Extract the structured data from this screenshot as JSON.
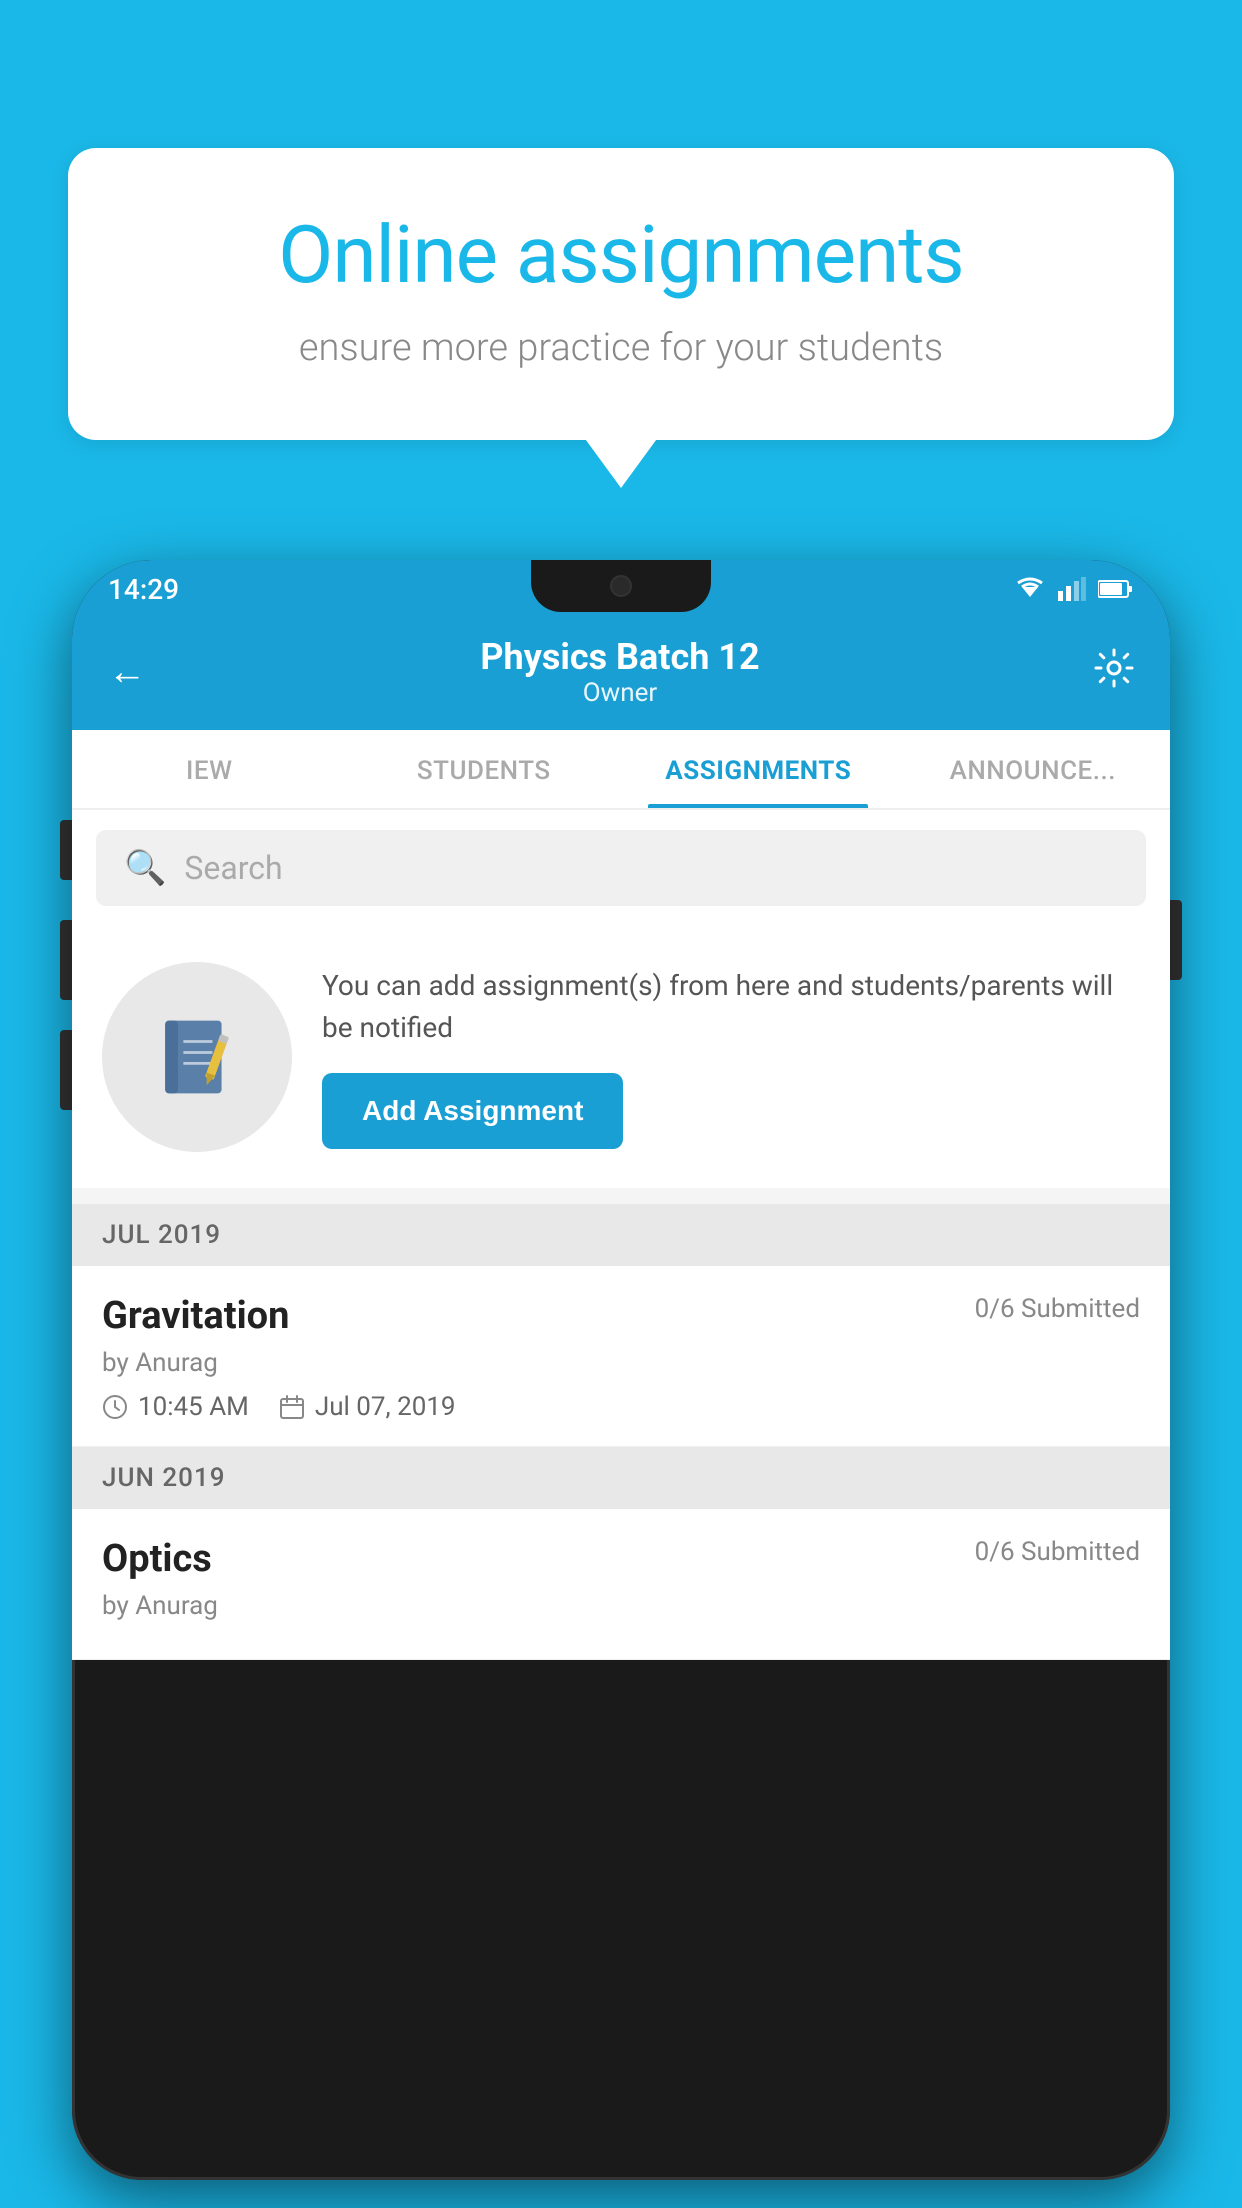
{
  "background": {
    "color": "#1ab8e8"
  },
  "speech_bubble": {
    "title": "Online assignments",
    "subtitle": "ensure more practice for your students"
  },
  "phone": {
    "status_bar": {
      "time": "14:29"
    },
    "header": {
      "title": "Physics Batch 12",
      "subtitle": "Owner"
    },
    "tabs": [
      {
        "label": "IEW",
        "active": false
      },
      {
        "label": "STUDENTS",
        "active": false
      },
      {
        "label": "ASSIGNMENTS",
        "active": true
      },
      {
        "label": "ANNOUNCEMENTS",
        "active": false
      }
    ],
    "search": {
      "placeholder": "Search"
    },
    "promo": {
      "description": "You can add assignment(s) from here and students/parents will be notified",
      "button_label": "Add Assignment"
    },
    "assignments": [
      {
        "month_header": "JUL 2019",
        "title": "Gravitation",
        "submitted": "0/6 Submitted",
        "author": "by Anurag",
        "time": "10:45 AM",
        "date": "Jul 07, 2019"
      },
      {
        "month_header": "JUN 2019",
        "title": "Optics",
        "submitted": "0/6 Submitted",
        "author": "by Anurag",
        "time": "",
        "date": ""
      }
    ]
  }
}
